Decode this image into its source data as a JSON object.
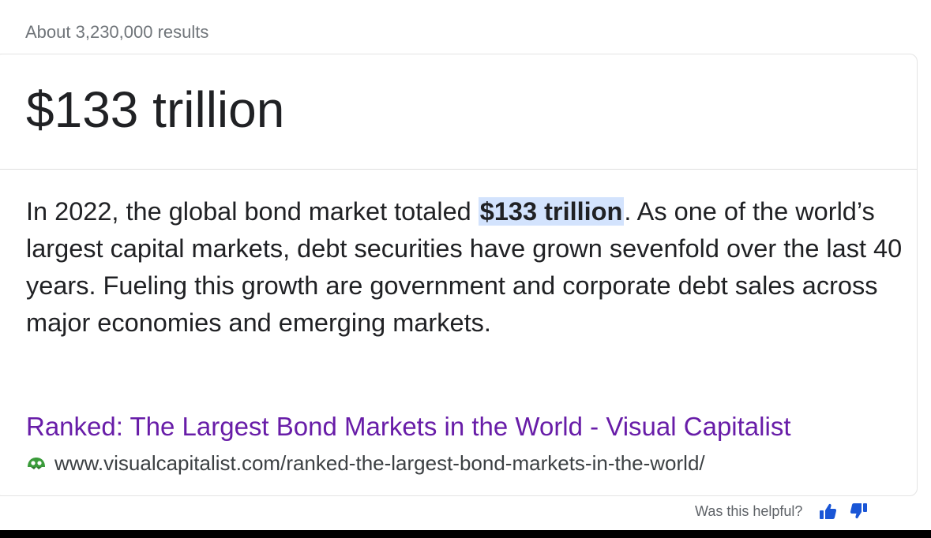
{
  "results_count": "About 3,230,000 results",
  "answer": {
    "title": "$133 trillion",
    "snippet_before": "In 2022, the global bond market totaled ",
    "snippet_highlight": "$133 trillion",
    "snippet_after": ". As one of the world’s largest capital markets, debt securities have grown sevenfold over the last 40 years. Fueling this growth are government and corporate debt sales across major economies and emerging markets."
  },
  "source": {
    "link_text": "Ranked: The Largest Bond Markets in the World - Visual Capitalist",
    "url": "www.visualcapitalist.com/ranked-the-largest-bond-markets-in-the-world/",
    "icon": "site-favicon-icon"
  },
  "feedback": {
    "label": "Was this helpful?",
    "like_icon": "thumbs-up-icon",
    "dislike_icon": "thumbs-down-icon"
  },
  "colors": {
    "link": "#681da8",
    "highlight": "#d3e3fd",
    "thumb": "#1a56d6",
    "favicon": "#3a9b3a"
  }
}
